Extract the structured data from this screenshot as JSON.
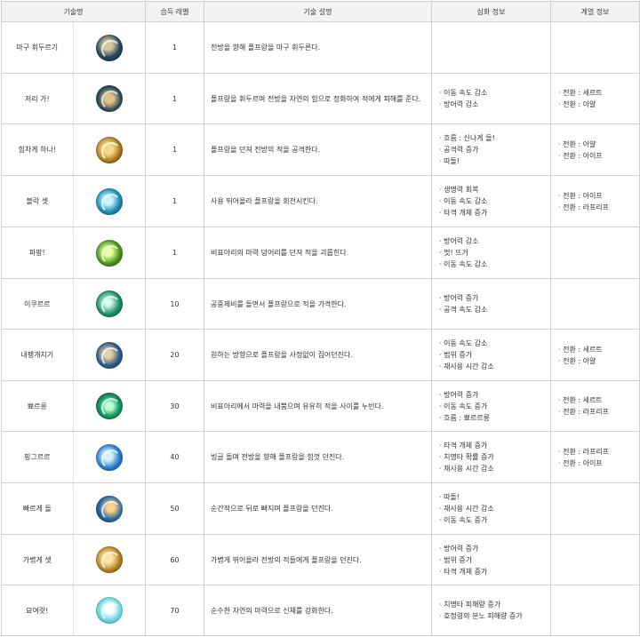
{
  "headers": {
    "col_name": "기술명",
    "col_level": "습득 레벨",
    "col_desc": "기술 설명",
    "col_deep": "심화 정보",
    "col_school": "계열 정보"
  },
  "skills": [
    {
      "name": "마구 휘두르기",
      "icon": "spinning-strike-icon",
      "level": "1",
      "desc": "전방을 향해 플프랑을 마구 휘두른다.",
      "deep": [],
      "school": []
    },
    {
      "name": "저리 가!",
      "icon": "nature-swing-icon",
      "level": "1",
      "desc": "플프랑을 휘두르며 전방을 자연의 힘으로 정화하여 적에게 피해를 준다.",
      "deep": [
        "· 이동 속도 감소",
        "· 방어력 감소"
      ],
      "school": [
        "· 전환 : 세르트",
        "· 전환 : 아얄"
      ]
    },
    {
      "name": "힘차게 하나!",
      "icon": "slam-icon",
      "level": "1",
      "desc": "플프랑을 던져 전방의 적을 공격한다.",
      "deep": [
        "· 흐름 : 신나게 돌!",
        "· 공격력 증가",
        "· 따돌!"
      ],
      "school": [
        "· 전환 : 아얄",
        "· 전환 : 아이프"
      ]
    },
    {
      "name": "블락 셋",
      "icon": "whirl-icon",
      "level": "1",
      "desc": "사용 뛰어올라 플프랑을 회전시킨다.",
      "deep": [
        "· 생명력 회복",
        "· 이동 속도 감소",
        "· 타격 개체 증가"
      ],
      "school": [
        "· 전환 : 아이프",
        "· 전환 : 라프리프"
      ]
    },
    {
      "name": "파팡!",
      "icon": "burst-icon",
      "level": "1",
      "desc": "비표아리의 마력 덩어리를 던져 적을 괴롭힌다.",
      "deep": [
        "· 방어력 감소",
        "· 멋! 뜨거",
        "· 이동 속도 감소"
      ],
      "school": []
    },
    {
      "name": "이쿠르르",
      "icon": "ring-icon",
      "level": "10",
      "desc": "공중제비를 돌면서 플프랑으로 적을 가격한다.",
      "deep": [
        "· 방어력 증가",
        "· 공격 속도 감소"
      ],
      "school": []
    },
    {
      "name": "내팽개치기",
      "icon": "throw-icon",
      "level": "20",
      "desc": "원하는 방향으로 플프랑을 사정없이 집어던진다.",
      "deep": [
        "· 이동 속도 감소",
        "· 범위 증가",
        "· 재사용 시간 감소"
      ],
      "school": [
        "· 전환 : 세르트",
        "· 전환 : 아얄"
      ]
    },
    {
      "name": "뾰르릉",
      "icon": "orb-icon",
      "level": "30",
      "desc": "비표아리에서 마력을 내뿜으며 유유히 적을 사이를 누빈다.",
      "deep": [
        "· 방어력 증가",
        "· 이동 속도 증가",
        "· 흐름 : 뾰르르릉"
      ],
      "school": [
        "· 전환 : 세르트",
        "· 전환 : 라프리프"
      ]
    },
    {
      "name": "핑그르르",
      "icon": "swirl-icon",
      "level": "40",
      "desc": "빙글 돌며 전방을 향해 플프랑을 힘껏 던진다.",
      "deep": [
        "· 타격 개체 증가",
        "· 치명타 확률 증가",
        "· 재사용 시간 감소"
      ],
      "school": [
        "· 전환 : 라프리프",
        "· 전환 : 아이프"
      ]
    },
    {
      "name": "빠르게 돌",
      "icon": "dash-icon",
      "level": "50",
      "desc": "순간적으로 뒤로 빠지며 플프랑을 던진다.",
      "deep": [
        "· 따돌!",
        "· 재사용 시간 감소",
        "· 이동 속도 증가"
      ],
      "school": []
    },
    {
      "name": "가볍게 셋",
      "icon": "leap-icon",
      "level": "60",
      "desc": "가볍게 뛰어올라 전방의 적들에게 플프랑을 던진다.",
      "deep": [
        "· 방어력 증가",
        "· 범위 증가",
        "· 타격 개체 증가"
      ],
      "school": []
    },
    {
      "name": "묘여랏!",
      "icon": "tree-icon",
      "level": "70",
      "desc": "순수한 자연의 마력으로 신체를 강화한다.",
      "deep": [
        "· 치명타 피해량 증가",
        "· 호정령의 분노 피해량 증가"
      ],
      "school": []
    }
  ]
}
